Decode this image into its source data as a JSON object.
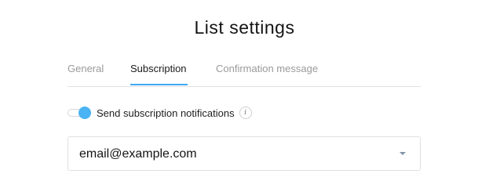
{
  "page": {
    "title": "List settings"
  },
  "tabs": [
    {
      "label": "General",
      "active": false
    },
    {
      "label": "Subscription",
      "active": true
    },
    {
      "label": "Confirmation message",
      "active": false
    }
  ],
  "notifications": {
    "label": "Send subscription notifications",
    "enabled": true,
    "info_icon": "info-icon",
    "info_glyph": "i"
  },
  "email_select": {
    "value": "email@example.com",
    "caret_icon": "caret-down-icon"
  },
  "colors": {
    "accent": "#3fa9f5",
    "toggle_on": "#4ab3f4",
    "tab_inactive": "#9a9a9a",
    "border": "#e0e0e0"
  }
}
